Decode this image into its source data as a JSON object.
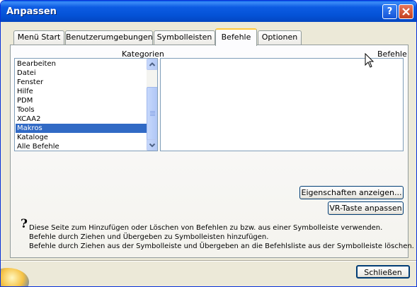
{
  "window": {
    "title": "Anpassen"
  },
  "tabs": [
    {
      "label": "Menü Start"
    },
    {
      "label": "Benutzerumgebungen"
    },
    {
      "label": "Symbolleisten"
    },
    {
      "label": "Befehle"
    },
    {
      "label": "Optionen"
    }
  ],
  "active_tab": "Befehle",
  "categories": {
    "label": "Kategorien",
    "items": [
      "Bearbeiten",
      "Datei",
      "Fenster",
      "Hilfe",
      "PDM",
      "Tools",
      "XCAA2",
      "Makros",
      "Kataloge",
      "Alle Befehle"
    ],
    "selected": "Makros"
  },
  "commands": {
    "label": "Befehle"
  },
  "buttons": {
    "properties": "Eigenschaften anzeigen...",
    "vr_key": "VR-Taste anpassen",
    "close": "Schließen"
  },
  "info": {
    "lines": [
      "Diese Seite zum Hinzufügen oder Löschen von Befehlen zu bzw. aus einer Symbolleiste verwenden.",
      "Befehle durch Ziehen und Übergeben zu Symbolleisten hinzufügen.",
      "Befehle durch Ziehen aus der Symbolleiste und Übergeben an die Befehlsliste aus der Symbolleiste löschen."
    ]
  },
  "icons": {
    "help": "question-mark-icon",
    "close": "close-x-icon",
    "info": "question-mark-icon"
  },
  "colors": {
    "titlebar": "#0452d6",
    "selection": "#316ac5",
    "dialog_bg": "#ece9d8",
    "active_tab_accent": "#ffc83c"
  }
}
